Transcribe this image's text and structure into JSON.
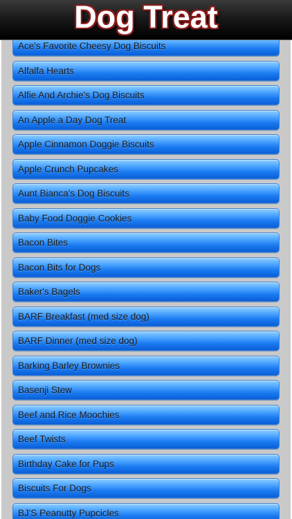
{
  "header": {
    "title": "Dog Treat"
  },
  "list": {
    "items": [
      {
        "label": "Ace's Favorite Cheesy Dog Biscuits"
      },
      {
        "label": "Alfalfa Hearts"
      },
      {
        "label": "Alfie And Archie's Dog Biscuits"
      },
      {
        "label": "An Apple a Day Dog Treat"
      },
      {
        "label": "Apple Cinnamon Doggie Biscuits"
      },
      {
        "label": "Apple Crunch Pupcakes"
      },
      {
        "label": "Aunt Bianca's Dog Biscuits"
      },
      {
        "label": "Baby Food Doggie Cookies"
      },
      {
        "label": "Bacon Bites"
      },
      {
        "label": "Bacon Bits for Dogs"
      },
      {
        "label": "Baker's Bagels"
      },
      {
        "label": "BARF Breakfast (med size dog)"
      },
      {
        "label": "BARF Dinner (med size dog)"
      },
      {
        "label": "Barking Barley Brownies"
      },
      {
        "label": "Basenji Stew"
      },
      {
        "label": "Beef and Rice Moochies"
      },
      {
        "label": "Beef Twists"
      },
      {
        "label": "Birthday Cake for Pups"
      },
      {
        "label": "Biscuits For Dogs"
      },
      {
        "label": "BJ'S Peanutty Pupcicles"
      }
    ]
  },
  "colors": {
    "header_bg": "#000000",
    "title_outline": "#8b1a1a",
    "button_blue": "#1a7af0",
    "background": "#c9c9c9"
  }
}
